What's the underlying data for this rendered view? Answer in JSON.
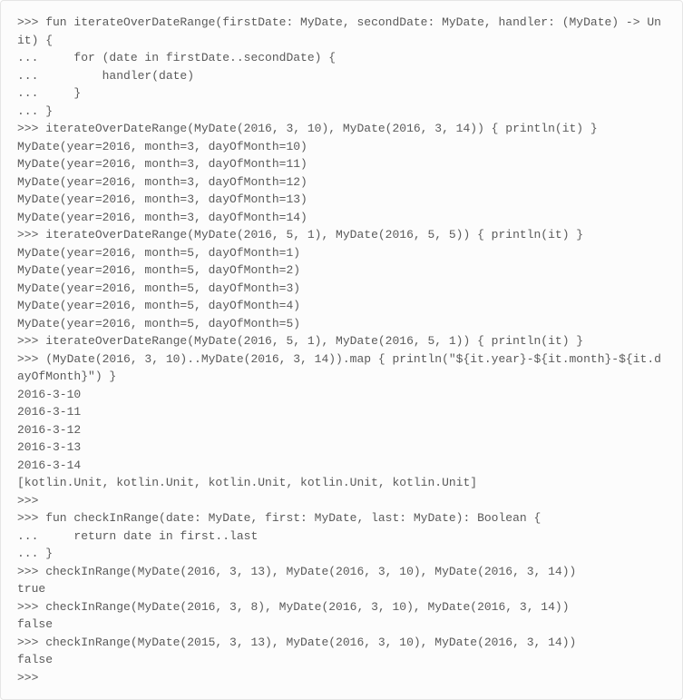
{
  "code": {
    "lines": [
      ">>> fun iterateOverDateRange(firstDate: MyDate, secondDate: MyDate, handler: (MyDate) -> Unit) {",
      "...     for (date in firstDate..secondDate) {",
      "...         handler(date)",
      "...     }",
      "... }",
      ">>> iterateOverDateRange(MyDate(2016, 3, 10), MyDate(2016, 3, 14)) { println(it) }",
      "MyDate(year=2016, month=3, dayOfMonth=10)",
      "MyDate(year=2016, month=3, dayOfMonth=11)",
      "MyDate(year=2016, month=3, dayOfMonth=12)",
      "MyDate(year=2016, month=3, dayOfMonth=13)",
      "MyDate(year=2016, month=3, dayOfMonth=14)",
      ">>> iterateOverDateRange(MyDate(2016, 5, 1), MyDate(2016, 5, 5)) { println(it) }",
      "MyDate(year=2016, month=5, dayOfMonth=1)",
      "MyDate(year=2016, month=5, dayOfMonth=2)",
      "MyDate(year=2016, month=5, dayOfMonth=3)",
      "MyDate(year=2016, month=5, dayOfMonth=4)",
      "MyDate(year=2016, month=5, dayOfMonth=5)",
      ">>> iterateOverDateRange(MyDate(2016, 5, 1), MyDate(2016, 5, 1)) { println(it) }",
      ">>> (MyDate(2016, 3, 10)..MyDate(2016, 3, 14)).map { println(\"${it.year}-${it.month}-${it.dayOfMonth}\") }",
      "2016-3-10",
      "2016-3-11",
      "2016-3-12",
      "2016-3-13",
      "2016-3-14",
      "[kotlin.Unit, kotlin.Unit, kotlin.Unit, kotlin.Unit, kotlin.Unit]",
      ">>>",
      ">>> fun checkInRange(date: MyDate, first: MyDate, last: MyDate): Boolean {",
      "...     return date in first..last",
      "... }",
      ">>> checkInRange(MyDate(2016, 3, 13), MyDate(2016, 3, 10), MyDate(2016, 3, 14))",
      "true",
      ">>> checkInRange(MyDate(2016, 3, 8), MyDate(2016, 3, 10), MyDate(2016, 3, 14))",
      "false",
      ">>> checkInRange(MyDate(2015, 3, 13), MyDate(2016, 3, 10), MyDate(2016, 3, 14))",
      "false",
      ">>>"
    ]
  }
}
